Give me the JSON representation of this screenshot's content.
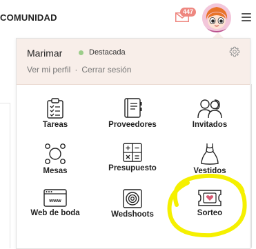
{
  "header": {
    "brand": "COMUNIDAD",
    "notifications_count": "447"
  },
  "user": {
    "name": "Marimar",
    "status": "Destacada",
    "status_color": "#9ccd8a",
    "view_profile": "Ver mi perfil",
    "separator": "·",
    "logout": "Cerrar sesión"
  },
  "tools": [
    {
      "label": "Tareas",
      "icon": "clipboard-checklist-icon"
    },
    {
      "label": "Proveedores",
      "icon": "address-book-icon"
    },
    {
      "label": "Invitados",
      "icon": "guests-icon"
    },
    {
      "label": "Mesas",
      "icon": "round-table-icon"
    },
    {
      "label": "Presupuesto",
      "icon": "calculator-icon"
    },
    {
      "label": "Vestidos",
      "icon": "dress-icon"
    },
    {
      "label": "Web de boda",
      "icon": "website-www-icon"
    },
    {
      "label": "Wedshoots",
      "icon": "camera-lens-icon"
    },
    {
      "label": "Sorteo",
      "icon": "ticket-heart-icon"
    }
  ],
  "colors": {
    "accent": "#ee8780",
    "highlight": "#f5f000",
    "userbox_bg": "#f8eee9"
  }
}
